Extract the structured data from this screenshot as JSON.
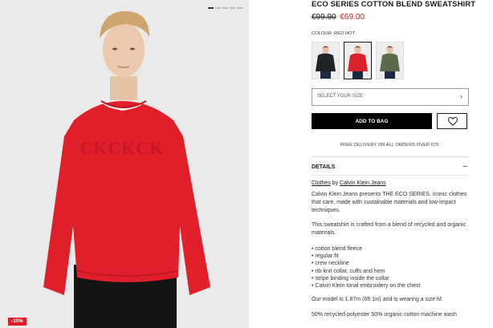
{
  "gallery": {
    "badge": "-30%",
    "dot_count": 5,
    "active_dot": 0,
    "sweater_color": "#e11f2a",
    "embroidery_text": "CKCKCK"
  },
  "product": {
    "title": "ECO SERIES COTTON BLEND SWEATSHIRT",
    "price_old": "€99.90",
    "price_new": "€69.00",
    "colour_label": "COLOUR: RED HOT",
    "swatches": [
      {
        "name": "black",
        "color": "#1f2226"
      },
      {
        "name": "red",
        "color": "#d8232d",
        "selected": true
      },
      {
        "name": "olive",
        "color": "#5c6b4d"
      }
    ],
    "size_placeholder": "SELECT YOUR SIZE",
    "add_to_bag": "ADD TO BAG",
    "delivery_note": "FREE DELIVERY ON ALL ORDERS OVER €75"
  },
  "details": {
    "heading": "DETAILS",
    "toggle": "–",
    "crumb_category": "Clothes",
    "crumb_by": "by",
    "crumb_brand": "Calvin Klein Jeans",
    "intro": "Calvin Klein Jeans presents THE ECO SERIES. Iconic clothes that care, made with sustainable materials and low-impact techniques.",
    "fabric": "This sweatshirt is crafted from a blend of recycled and organic materials.",
    "features": [
      "cotton blend fleece",
      "regular fit",
      "crew neckline",
      "rib-knit collar, cuffs and hem",
      "stripe binding inside the collar",
      "Calvin Klein tonal embroidery on the chest"
    ],
    "model_note": "Our model is 1.87m (6ft 1in) and is wearing a size M.",
    "composition": "50% recycled polyester 50% organic cotton machine wash"
  }
}
